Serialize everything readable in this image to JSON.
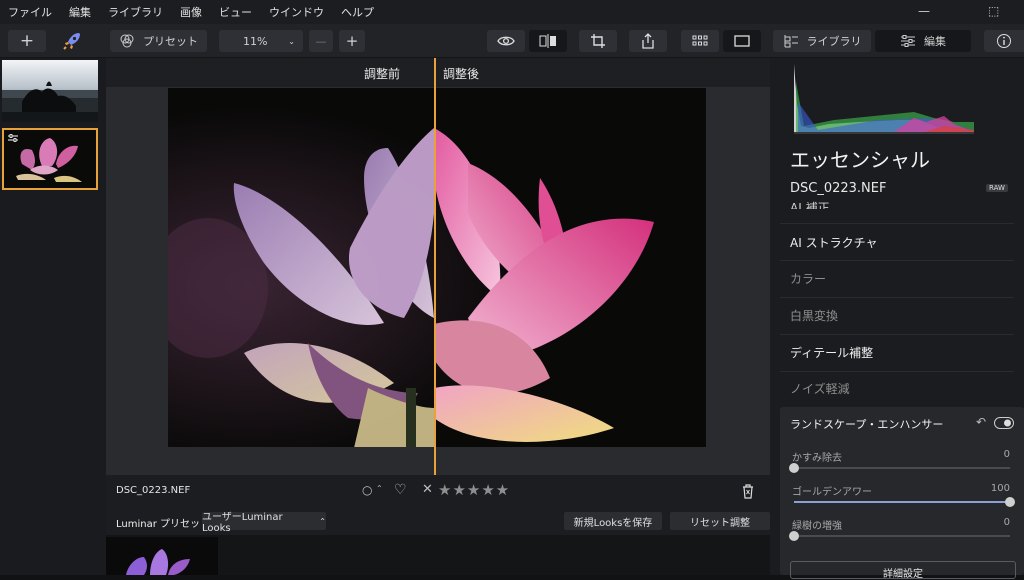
{
  "menu": [
    "ファイル",
    "編集",
    "ライブラリ",
    "画像",
    "ビュー",
    "ウインドウ",
    "ヘルプ"
  ],
  "window_controls": {
    "minimize": "—",
    "maximize": "⬚"
  },
  "toolbar": {
    "add": "+",
    "presets_label": "プリセット",
    "zoom_value": "11%",
    "zoom_out": "—",
    "zoom_in": "+",
    "library_label": "ライブラリ",
    "edit_label": "編集"
  },
  "viewer": {
    "before_label": "調整前",
    "after_label": "調整後"
  },
  "infobar": {
    "filename": "DSC_0223.NEF",
    "rating": "★★★★★",
    "reject": "✕",
    "flag": "○",
    "heart": "♡"
  },
  "presetbar": {
    "title": "Luminar プリセット",
    "category": "ユーザーLuminar Looks",
    "save_button": "新規Looksを保存",
    "reset_button": "リセット調整"
  },
  "panel": {
    "section_title": "エッセンシャル",
    "filename": "DSC_0223.NEF",
    "raw_badge": "RAW",
    "tools": [
      "AI 補正",
      "AI ストラクチャ",
      "カラー",
      "白黒変換",
      "ディテール補整",
      "ノイズ軽減"
    ],
    "subpanel": {
      "title": "ランドスケープ・エンハンサー",
      "sliders": [
        {
          "label": "かすみ除去",
          "value": "0",
          "level": 0
        },
        {
          "label": "ゴールデンアワー",
          "value": "100",
          "level": 1
        },
        {
          "label": "緑樹の増強",
          "value": "0",
          "level": 0
        }
      ],
      "advanced_button": "詳細設定"
    }
  },
  "colors": {
    "accent": "#e9a23b",
    "background": "#111214",
    "panel": "#1b1c1f"
  }
}
